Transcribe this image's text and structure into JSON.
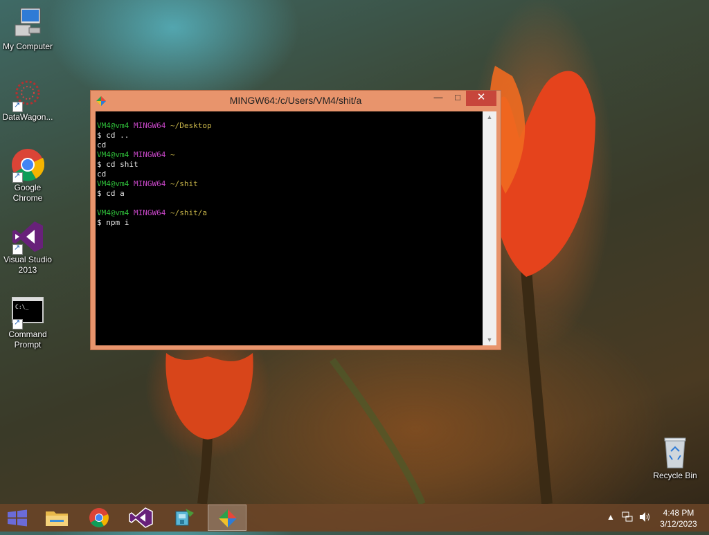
{
  "desktop": {
    "icons": [
      {
        "label": "My Computer",
        "icon": "computer-icon"
      },
      {
        "label": "DataWagon...",
        "icon": "datawagon-icon"
      },
      {
        "label": "Google Chrome",
        "icon": "chrome-icon"
      },
      {
        "label": "Visual Studio 2013",
        "icon": "visual-studio-icon"
      },
      {
        "label": "Command Prompt",
        "icon": "command-prompt-icon"
      },
      {
        "label": "Recycle Bin",
        "icon": "recycle-bin-icon"
      }
    ]
  },
  "terminal": {
    "title": "MINGW64:/c/Users/VM4/shit/a",
    "lines": [
      {
        "user": "VM4@vm4",
        "host": "MINGW64",
        "path": "~/Desktop"
      },
      {
        "text": "$ cd .."
      },
      {
        "text": "cd"
      },
      {
        "user": "VM4@vm4",
        "host": "MINGW64",
        "path": "~"
      },
      {
        "text": "$ cd shit"
      },
      {
        "text": "cd"
      },
      {
        "user": "VM4@vm4",
        "host": "MINGW64",
        "path": "~/shit"
      },
      {
        "text": "$ cd a"
      },
      {
        "text": ""
      },
      {
        "user": "VM4@vm4",
        "host": "MINGW64",
        "path": "~/shit/a"
      },
      {
        "text": "$ npm i"
      }
    ]
  },
  "taskbar": {
    "items": [
      "start-icon",
      "file-explorer-icon",
      "chrome-icon",
      "visual-studio-icon",
      "setup-icon",
      "git-bash-icon"
    ],
    "active": "git-bash-icon",
    "clock": {
      "time": "4:48 PM",
      "date": "3/12/2023"
    }
  },
  "colors": {
    "prompt_user": "#2fbf3a",
    "prompt_host": "#c847c8",
    "prompt_path": "#c9b64a",
    "close": "#c7463b"
  }
}
